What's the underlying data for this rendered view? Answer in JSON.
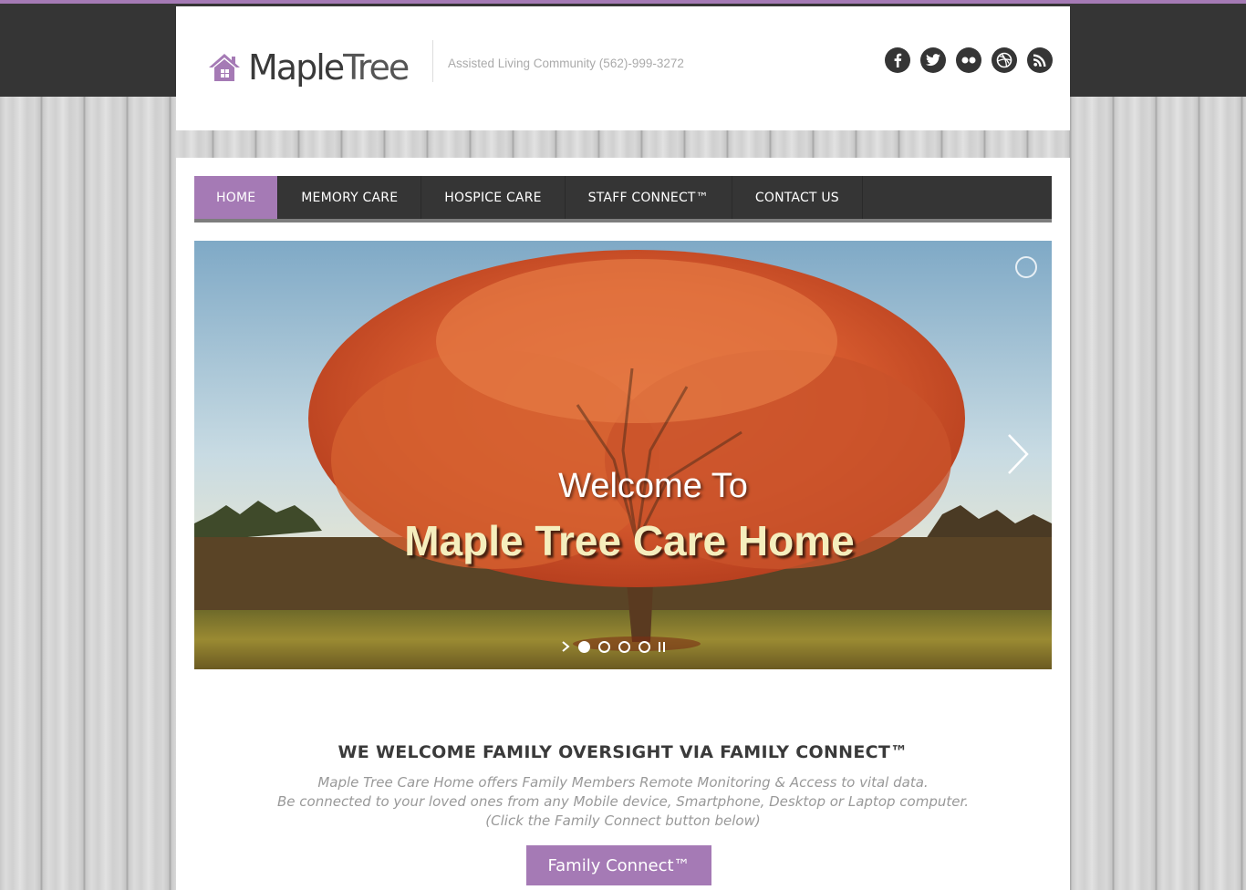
{
  "header": {
    "logo_text_bold": "Maple",
    "logo_text_light": "Tree",
    "tagline": "Assisted Living Community (562)-999-3272",
    "social_icons": [
      "facebook-icon",
      "twitter-icon",
      "flickr-icon",
      "dribbble-icon",
      "rss-icon"
    ]
  },
  "nav": {
    "items": [
      {
        "label": "HOME",
        "active": true
      },
      {
        "label": "MEMORY CARE",
        "active": false
      },
      {
        "label": "HOSPICE CARE",
        "active": false
      },
      {
        "label": "STAFF CONNECT™",
        "active": false
      },
      {
        "label": "CONTACT US",
        "active": false
      }
    ]
  },
  "slider": {
    "welcome": "Welcome To",
    "title": "Maple Tree Care Home",
    "slide_count": 4,
    "active_slide": 1
  },
  "intro": {
    "heading": "WE WELCOME FAMILY OVERSIGHT VIA FAMILY CONNECT™",
    "line1": "Maple Tree Care Home offers Family Members Remote Monitoring & Access to vital data.",
    "line2": "Be connected to your loved ones from any Mobile device, Smartphone, Desktop or Laptop computer.",
    "line3": "(Click the Family Connect button below)",
    "button_label": "Family Connect™"
  },
  "colors": {
    "accent": "#a57ab5",
    "dark": "#353535",
    "text_muted": "#999999"
  }
}
